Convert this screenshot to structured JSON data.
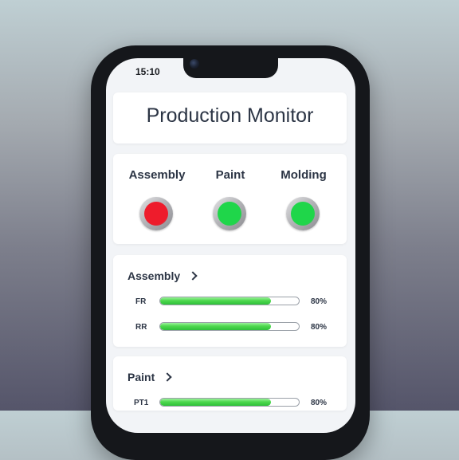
{
  "status_bar": {
    "time": "15:10"
  },
  "app": {
    "title": "Production Monitor"
  },
  "lines": [
    {
      "label": "Assembly",
      "status": "red",
      "color": "#ee1c2c"
    },
    {
      "label": "Paint",
      "status": "green",
      "color": "#1fd64a"
    },
    {
      "label": "Molding",
      "status": "green",
      "color": "#1fd64a"
    }
  ],
  "sections": [
    {
      "title": "Assembly",
      "metrics": [
        {
          "label": "FR",
          "value": 0.8,
          "value_text": "80%"
        },
        {
          "label": "RR",
          "value": 0.8,
          "value_text": "80%"
        }
      ]
    },
    {
      "title": "Paint",
      "metrics": [
        {
          "label": "PT1",
          "value": 0.8,
          "value_text": "80%"
        }
      ]
    }
  ],
  "icons": {
    "expand": "chevron-right-icon",
    "camera": "front-camera-icon"
  },
  "colors": {
    "ok": "#1fd64a",
    "alarm": "#ee1c2c",
    "bar_fill": "#44d34a"
  }
}
